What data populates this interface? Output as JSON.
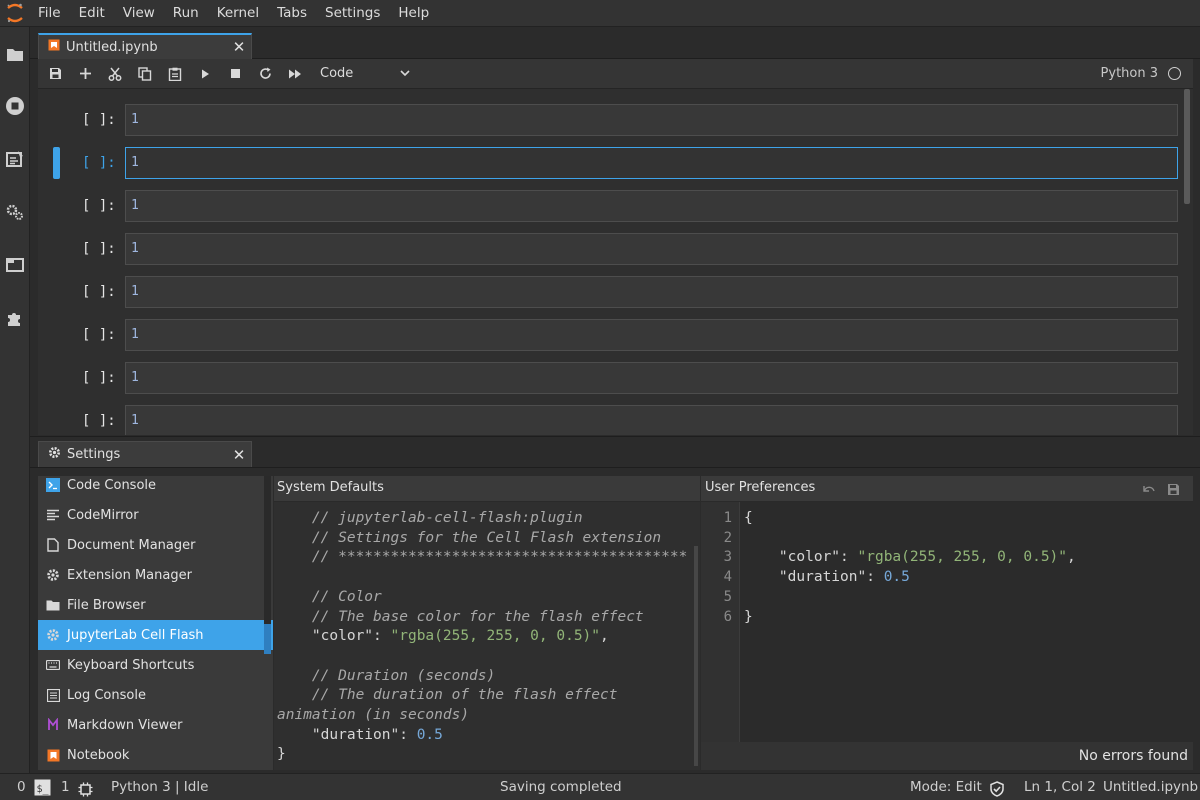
{
  "menu": [
    "File",
    "Edit",
    "View",
    "Run",
    "Kernel",
    "Tabs",
    "Settings",
    "Help"
  ],
  "left_sidebar_icons": [
    "folder-icon",
    "running-icon",
    "commands-icon",
    "property-inspector-icon",
    "tabs-icon",
    "extension-icon"
  ],
  "notebook": {
    "tab_title": "Untitled.ipynb",
    "toolbar": {
      "buttons": [
        "save",
        "insert-cell",
        "cut",
        "copy",
        "paste",
        "run",
        "interrupt",
        "restart",
        "restart-run-all"
      ],
      "cell_type": "Code",
      "kernel_name": "Python 3"
    },
    "cells": [
      {
        "prompt": "[ ]:",
        "code": "1"
      },
      {
        "prompt": "[ ]:",
        "code": "1"
      },
      {
        "prompt": "[ ]:",
        "code": "1"
      },
      {
        "prompt": "[ ]:",
        "code": "1"
      },
      {
        "prompt": "[ ]:",
        "code": "1"
      },
      {
        "prompt": "[ ]:",
        "code": "1"
      },
      {
        "prompt": "[ ]:",
        "code": "1"
      },
      {
        "prompt": "[ ]:",
        "code": "1"
      }
    ],
    "active_cell_index": 1
  },
  "settings": {
    "tab_title": "Settings",
    "plugins": [
      {
        "label": "Code Console",
        "icon": "console-icon"
      },
      {
        "label": "CodeMirror",
        "icon": "text-editor-icon"
      },
      {
        "label": "Document Manager",
        "icon": "file-icon"
      },
      {
        "label": "Extension Manager",
        "icon": "gear-icon"
      },
      {
        "label": "File Browser",
        "icon": "folder-icon"
      },
      {
        "label": "JupyterLab Cell Flash",
        "icon": "gear-icon"
      },
      {
        "label": "Keyboard Shortcuts",
        "icon": "keyboard-icon"
      },
      {
        "label": "Log Console",
        "icon": "list-icon"
      },
      {
        "label": "Markdown Viewer",
        "icon": "markdown-icon"
      },
      {
        "label": "Notebook",
        "icon": "notebook-icon"
      }
    ],
    "selected_plugin_index": 5,
    "system_defaults": {
      "header": "System Defaults",
      "lines": [
        {
          "indent": "    ",
          "kind": "comment",
          "text": "// jupyterlab-cell-flash:plugin"
        },
        {
          "indent": "    ",
          "kind": "comment",
          "text": "// Settings for the Cell Flash extension"
        },
        {
          "indent": "    ",
          "kind": "comment",
          "text": "// ****************************************"
        },
        {
          "indent": "",
          "kind": "blank",
          "text": ""
        },
        {
          "indent": "    ",
          "kind": "comment",
          "text": "// Color"
        },
        {
          "indent": "    ",
          "kind": "comment",
          "text": "// The base color for the flash effect"
        },
        {
          "indent": "    ",
          "kind": "kv",
          "key": "\"color\"",
          "sep": ": ",
          "value": "\"rgba(255, 255, 0, 0.5)\"",
          "value_kind": "string",
          "tail": ","
        },
        {
          "indent": "",
          "kind": "blank",
          "text": ""
        },
        {
          "indent": "    ",
          "kind": "comment",
          "text": "// Duration (seconds)"
        },
        {
          "indent": "    ",
          "kind": "comment",
          "text": "// The duration of the flash effect"
        },
        {
          "indent": "",
          "kind": "comment",
          "text": "animation (in seconds)"
        },
        {
          "indent": "    ",
          "kind": "kv",
          "key": "\"duration\"",
          "sep": ": ",
          "value": "0.5",
          "value_kind": "number",
          "tail": ""
        },
        {
          "indent": "",
          "kind": "plain",
          "text": "}"
        }
      ]
    },
    "user_preferences": {
      "header": "User Preferences",
      "line_numbers": [
        "1",
        "2",
        "3",
        "4",
        "5",
        "6"
      ],
      "lines": [
        {
          "indent": "",
          "kind": "plain",
          "text": "{"
        },
        {
          "indent": "",
          "kind": "blank",
          "text": ""
        },
        {
          "indent": "    ",
          "kind": "kv",
          "key": "\"color\"",
          "sep": ": ",
          "value": "\"rgba(255, 255, 0, 0.5)\"",
          "value_kind": "string",
          "tail": ","
        },
        {
          "indent": "    ",
          "kind": "kv",
          "key": "\"duration\"",
          "sep": ": ",
          "value": "0.5",
          "value_kind": "number",
          "tail": ""
        },
        {
          "indent": "",
          "kind": "blank",
          "text": ""
        },
        {
          "indent": "",
          "kind": "plain",
          "text": "}"
        }
      ],
      "validation": "No errors found"
    }
  },
  "statusbar": {
    "terminals_count": "0",
    "kernels_count": "1",
    "kernel_status": "Python 3 | Idle",
    "message": "Saving completed",
    "mode": "Mode: Edit",
    "cursor": "Ln 1, Col 2",
    "file": "Untitled.ipynb"
  },
  "colors": {
    "accent": "#3ea3e9",
    "background": "#2b2b2b",
    "panel": "#3a3a3a"
  }
}
